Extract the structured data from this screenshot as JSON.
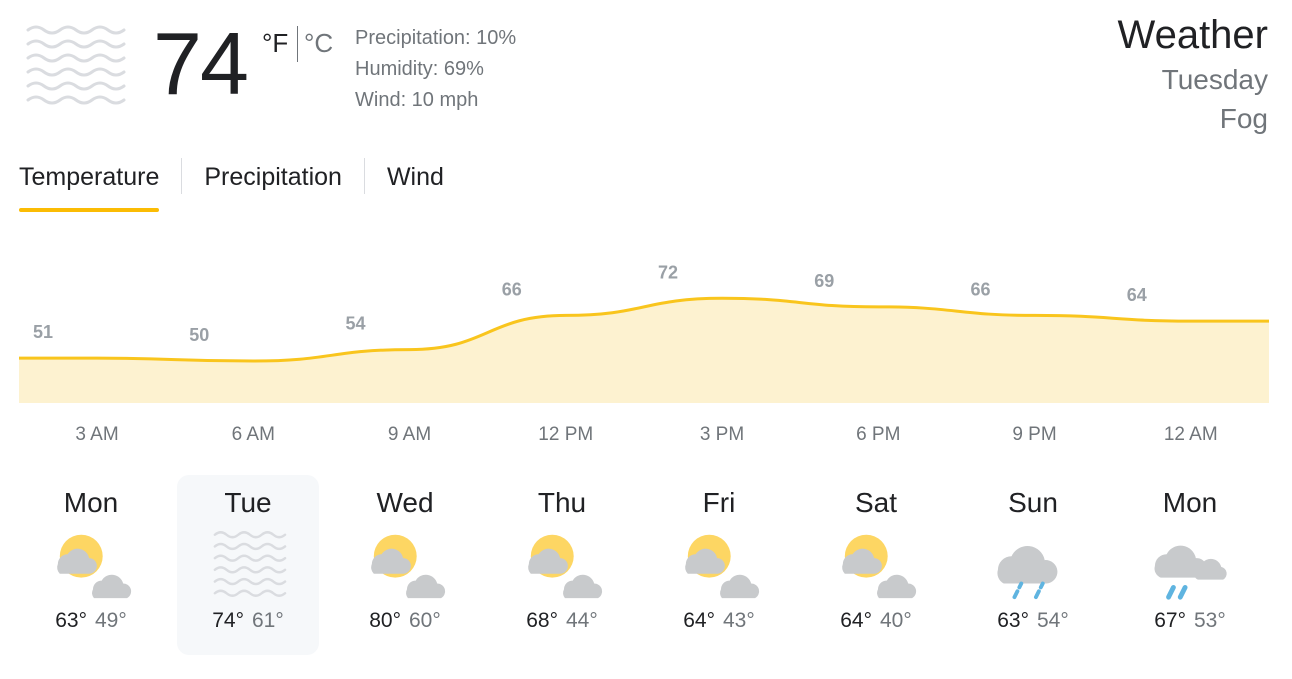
{
  "current": {
    "temperature": "74",
    "unit_f": "°F",
    "unit_c": "°C",
    "icon": "fog-icon",
    "precipitation": "Precipitation: 10%",
    "humidity": "Humidity: 69%",
    "wind": "Wind: 10 mph"
  },
  "header": {
    "title": "Weather",
    "day": "Tuesday",
    "condition": "Fog"
  },
  "tabs": [
    {
      "label": "Temperature",
      "active": true
    },
    {
      "label": "Precipitation",
      "active": false
    },
    {
      "label": "Wind",
      "active": false
    }
  ],
  "colors": {
    "accent": "#fbbc04",
    "chart_line": "#f9c51d",
    "chart_fill": "#fdf2d0",
    "muted_text": "#70757a"
  },
  "chart_data": {
    "type": "area",
    "x": [
      "3 AM",
      "6 AM",
      "9 AM",
      "12 PM",
      "3 PM",
      "6 PM",
      "9 PM",
      "12 AM"
    ],
    "values": [
      51,
      50,
      54,
      66,
      72,
      69,
      66,
      64
    ],
    "title": "",
    "xlabel": "",
    "ylabel": ""
  },
  "forecast": [
    {
      "day": "Mon",
      "icon": "partly-cloudy-icon",
      "high": "63°",
      "low": "49°",
      "selected": false
    },
    {
      "day": "Tue",
      "icon": "fog-icon",
      "high": "74°",
      "low": "61°",
      "selected": true
    },
    {
      "day": "Wed",
      "icon": "partly-cloudy-icon",
      "high": "80°",
      "low": "60°",
      "selected": false
    },
    {
      "day": "Thu",
      "icon": "partly-cloudy-icon",
      "high": "68°",
      "low": "44°",
      "selected": false
    },
    {
      "day": "Fri",
      "icon": "partly-cloudy-icon",
      "high": "64°",
      "low": "43°",
      "selected": false
    },
    {
      "day": "Sat",
      "icon": "partly-cloudy-icon",
      "high": "64°",
      "low": "40°",
      "selected": false
    },
    {
      "day": "Sun",
      "icon": "rain-icon",
      "high": "63°",
      "low": "54°",
      "selected": false
    },
    {
      "day": "Mon",
      "icon": "showers-icon",
      "high": "67°",
      "low": "53°",
      "selected": false
    }
  ]
}
